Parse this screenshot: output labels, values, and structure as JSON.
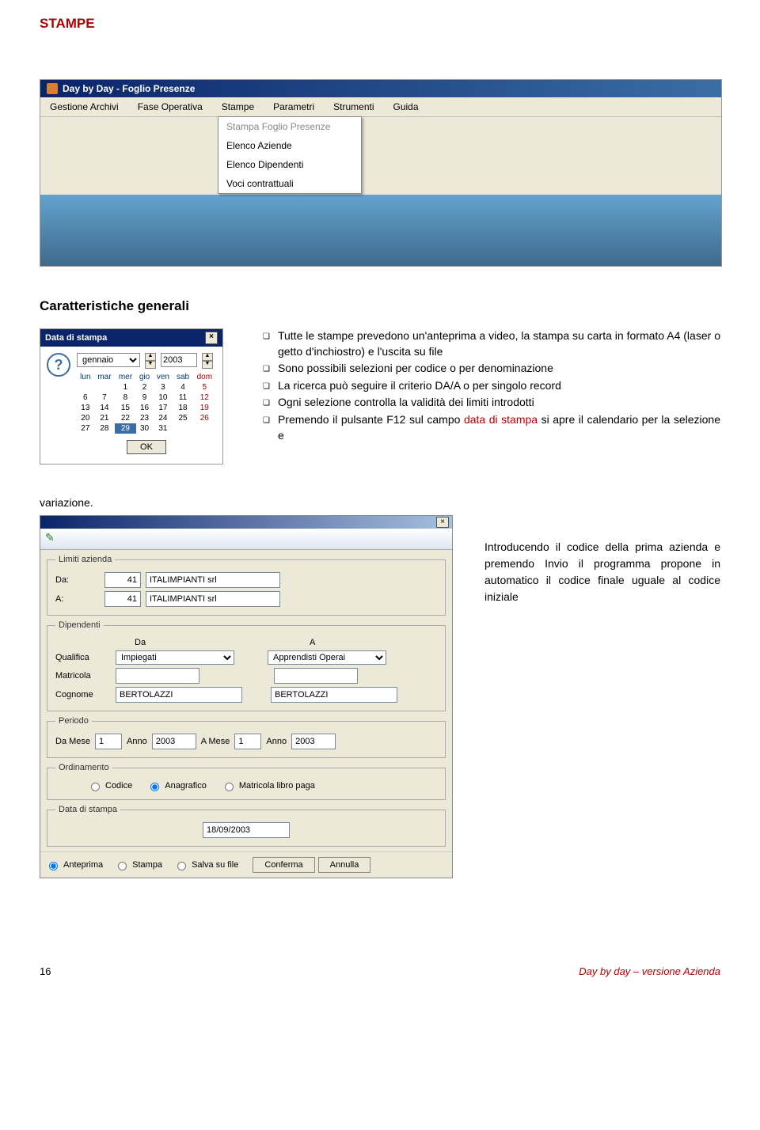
{
  "title": "STAMPE",
  "heading2": "Caratteristiche generali",
  "window1": {
    "title": "Day by Day - Foglio Presenze",
    "menu": [
      "Gestione Archivi",
      "Fase Operativa",
      "Stampe",
      "Parametri",
      "Strumenti",
      "Guida"
    ],
    "dropdown": [
      "Stampa Foglio Presenze",
      "Elenco Aziende",
      "Elenco Dipendenti",
      "Voci contrattuali"
    ]
  },
  "calendar": {
    "title": "Data di stampa",
    "month": "gennaio",
    "year": "2003",
    "dow": [
      "lun",
      "mar",
      "mer",
      "gio",
      "ven",
      "sab",
      "dom"
    ],
    "weeks": [
      [
        "",
        "",
        "1",
        "2",
        "3",
        "4",
        "5"
      ],
      [
        "6",
        "7",
        "8",
        "9",
        "10",
        "11",
        "12"
      ],
      [
        "13",
        "14",
        "15",
        "16",
        "17",
        "18",
        "19"
      ],
      [
        "20",
        "21",
        "22",
        "23",
        "24",
        "25",
        "26"
      ],
      [
        "27",
        "28",
        "29",
        "30",
        "31",
        "",
        ""
      ]
    ],
    "today_cell": "29",
    "ok": "OK"
  },
  "bullets": [
    {
      "pre": "Tutte le stampe prevedono un'anteprima a video, la stampa su carta in formato A4 (laser o getto d'inchiostro) e l'uscita su file",
      "red": ""
    },
    {
      "pre": "Sono possibili selezioni per codice o per denominazione",
      "red": ""
    },
    {
      "pre": "La ricerca può seguire il criterio DA/A o per singolo record",
      "red": ""
    },
    {
      "pre": "Ogni selezione controlla la validità dei limiti introdotti",
      "red": ""
    },
    {
      "pre": "Premendo il pulsante F12 sul campo ",
      "red": "data di stampa",
      "post": " si apre il calendario per la selezione e"
    }
  ],
  "variazione": "variazione.",
  "form": {
    "limiti_legend": "Limiti azienda",
    "da": "Da:",
    "a": "A:",
    "az_code": "41",
    "az_name": "ITALIMPIANTI srl",
    "dip_legend": "Dipendenti",
    "col_da": "Da",
    "col_a": "A",
    "qualifica_lbl": "Qualifica",
    "qualifica_da": "Impiegati",
    "qualifica_a": "Apprendisti Operai",
    "matricola_lbl": "Matricola",
    "cognome_lbl": "Cognome",
    "cognome_da": "BERTOLAZZI",
    "cognome_a": "BERTOLAZZI",
    "periodo_legend": "Periodo",
    "damese": "Da Mese",
    "amese": "A Mese",
    "anno": "Anno",
    "m1": "1",
    "y1": "2003",
    "m2": "1",
    "y2": "2003",
    "ord_legend": "Ordinamento",
    "ord_options": [
      "Codice",
      "Anagrafico",
      "Matricola libro paga"
    ],
    "ord_selected": 1,
    "data_legend": "Data di stampa",
    "data_val": "18/09/2003",
    "out_options": [
      "Anteprima",
      "Stampa",
      "Salva su file"
    ],
    "out_selected": 0,
    "btn_conferma": "Conferma",
    "btn_annulla": "Annulla"
  },
  "side_text": "Introducendo il codice della prima azienda e premendo Invio il programma propone in automatico il codice finale uguale al codice iniziale",
  "footer": {
    "page": "16",
    "right": "Day by day – versione Azienda"
  }
}
